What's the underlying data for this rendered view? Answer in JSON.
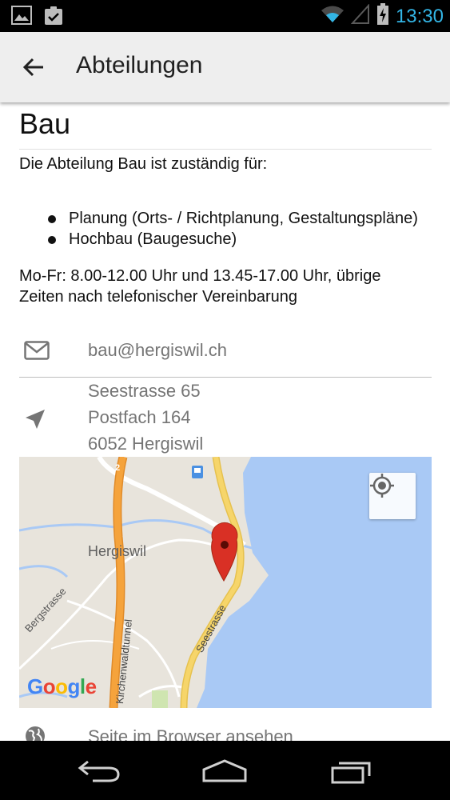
{
  "status_bar": {
    "time": "13:30"
  },
  "app_bar": {
    "title": "Abteilungen"
  },
  "department": {
    "title": "Bau",
    "intro": "Die Abteilung Bau ist zuständig für:",
    "responsibilities": [
      "Planung (Orts- / Richtplanung, Gestaltungspläne)",
      "Hochbau (Baugesuche)"
    ],
    "hours_line1": "Mo-Fr: 8.00-12.00 Uhr und 13.45-17.00 Uhr, übrige",
    "hours_line2": "Zeiten nach telefonischer Vereinbarung"
  },
  "contact": {
    "email": "bau@hergiswil.ch",
    "address": [
      "Seestrasse 65",
      "Postfach 164",
      "6052 Hergiswil"
    ],
    "browser_link": "Seite im Browser ansehen"
  },
  "map": {
    "place_label": "Hergiswil",
    "street_labels": [
      "Bergstrasse",
      "Kirchenwaldtunnel",
      "Seestrasse"
    ],
    "road_number": "2",
    "google_letters": [
      "G",
      "o",
      "o",
      "g",
      "l",
      "e"
    ],
    "colors": {
      "land": "#e8e4dc",
      "water": "#a9c9f5",
      "highway": "#f5a33c",
      "main_road": "#f6d56a",
      "pin": "#d93025"
    }
  },
  "colors": {
    "status_accent": "#33b5e5",
    "app_bar": "#eeeeee",
    "secondary_text": "#757575"
  }
}
